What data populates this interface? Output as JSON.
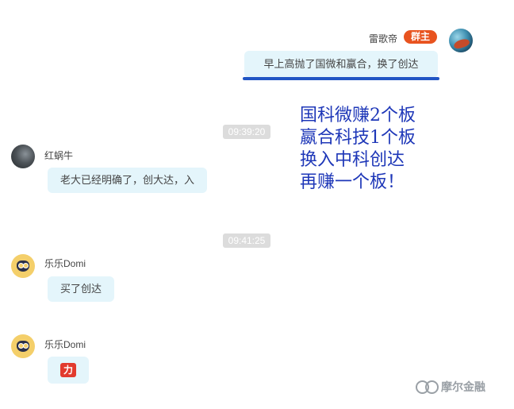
{
  "messages": {
    "m1": {
      "sender": "雷歌帝",
      "badge": "群主",
      "text": "早上高抛了国微和嬴合，换了创达"
    },
    "ts1": "09:39:20",
    "m2": {
      "sender": "红蜗牛",
      "text": "老大已经明确了，创大达，入"
    },
    "ts2": "09:41:25",
    "m3": {
      "sender": "乐乐Domi",
      "text": "买了创达"
    },
    "m4": {
      "sender": "乐乐Domi",
      "sticker": "力"
    }
  },
  "annotation": {
    "line1": "国科微赚2个板",
    "line2": "嬴合科技1个板",
    "line3": "换入中科创达",
    "line4": "再赚一个板！"
  },
  "watermark": {
    "text": "摩尔金融"
  },
  "colors": {
    "bubble": "#e4f5fb",
    "badge": "#e8531f",
    "annotation": "#1e37b8",
    "underline": "#2155c4"
  }
}
